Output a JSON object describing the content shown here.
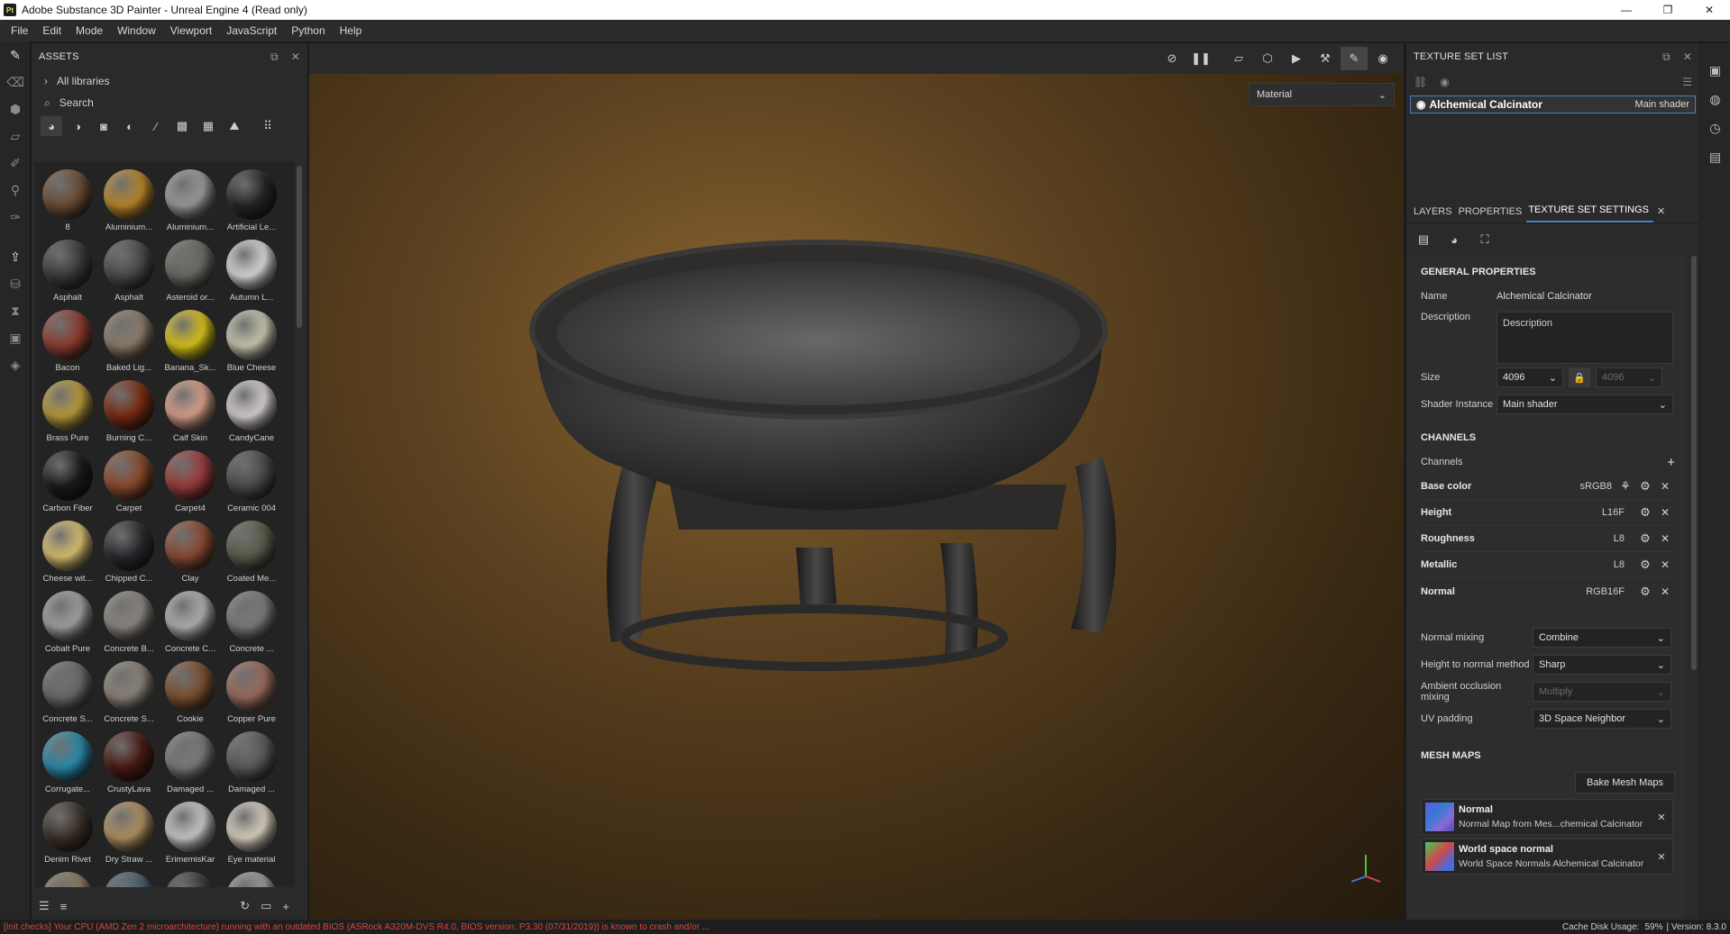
{
  "window": {
    "title": "Adobe Substance 3D Painter - Unreal Engine 4 (Read only)",
    "app_badge": "Pt",
    "minimize": "—",
    "maximize": "❐",
    "close": "✕"
  },
  "menu": [
    "File",
    "Edit",
    "Mode",
    "Window",
    "Viewport",
    "JavaScript",
    "Python",
    "Help"
  ],
  "assets": {
    "title": "ASSETS",
    "libraries": "All libraries",
    "search_placeholder": "Search",
    "items": [
      {
        "label": "8",
        "color": "#6b4c33"
      },
      {
        "label": "Aluminium...",
        "color": "#b8862a"
      },
      {
        "label": "Aluminium...",
        "color": "#9a9a9a"
      },
      {
        "label": "Artificial Le...",
        "color": "#262626"
      },
      {
        "label": "Asphalt",
        "color": "#3b3b3b"
      },
      {
        "label": "Asphalt",
        "color": "#4a4a4a"
      },
      {
        "label": "Asteroid or...",
        "color": "#6a6a62"
      },
      {
        "label": "Autumn L...",
        "color": "#d8d8d8"
      },
      {
        "label": "Bacon",
        "color": "#8c3b2e"
      },
      {
        "label": "Baked Lig...",
        "color": "#8c7c6a"
      },
      {
        "label": "Banana_Sk...",
        "color": "#d9c21a"
      },
      {
        "label": "Blue Cheese",
        "color": "#c9c6b0"
      },
      {
        "label": "Brass Pure",
        "color": "#b89a3a"
      },
      {
        "label": "Burning C...",
        "color": "#7a2a10"
      },
      {
        "label": "Calf Skin",
        "color": "#d8a08a"
      },
      {
        "label": "CandyCane",
        "color": "#d6d0d0"
      },
      {
        "label": "Carbon Fiber",
        "color": "#1a1a1a"
      },
      {
        "label": "Carpet",
        "color": "#8a4a2a"
      },
      {
        "label": "Carpet4",
        "color": "#9a3a3a"
      },
      {
        "label": "Ceramic 004",
        "color": "#4a4a4a"
      },
      {
        "label": "Cheese wit...",
        "color": "#d8c070"
      },
      {
        "label": "Chipped C...",
        "color": "#2a2a2e"
      },
      {
        "label": "Clay",
        "color": "#8a4a32"
      },
      {
        "label": "Coated Me...",
        "color": "#5a5a4a"
      },
      {
        "label": "Cobalt Pure",
        "color": "#a0a0a4"
      },
      {
        "label": "Concrete B...",
        "color": "#8a8680"
      },
      {
        "label": "Concrete C...",
        "color": "#b0b0b0"
      },
      {
        "label": "Concrete ...",
        "color": "#7a7a78"
      },
      {
        "label": "Concrete S...",
        "color": "#6a6a6a"
      },
      {
        "label": "Concrete S...",
        "color": "#8a8278"
      },
      {
        "label": "Cookie",
        "color": "#7a5030"
      },
      {
        "label": "Copper Pure",
        "color": "#9a6a5a"
      },
      {
        "label": "Corrugate...",
        "color": "#2a8aaa"
      },
      {
        "label": "CrustyLava",
        "color": "#4a1a12"
      },
      {
        "label": "Damaged ...",
        "color": "#7a7a78"
      },
      {
        "label": "Damaged ...",
        "color": "#5a5a5a"
      },
      {
        "label": "Denim Rivet",
        "color": "#3a3028"
      },
      {
        "label": "Dry Straw ...",
        "color": "#b09060"
      },
      {
        "label": "ErimemisKar",
        "color": "#c8c8c8"
      },
      {
        "label": "Eye material",
        "color": "#d8d0c0"
      },
      {
        "label": "",
        "color": "#8a7a60"
      },
      {
        "label": "",
        "color": "#4a6070"
      },
      {
        "label": "",
        "color": "#3a3a3a"
      },
      {
        "label": "",
        "color": "#9a9a9a"
      }
    ]
  },
  "viewport": {
    "mode": "Material"
  },
  "texture_set_list": {
    "title": "TEXTURE SET LIST",
    "set_name": "Alchemical Calcinator",
    "shader": "Main shader"
  },
  "tabs": {
    "layers": "LAYERS",
    "properties": "PROPERTIES",
    "tss": "TEXTURE SET SETTINGS"
  },
  "tss": {
    "general": "GENERAL PROPERTIES",
    "name_label": "Name",
    "name_value": "Alchemical Calcinator",
    "desc_label": "Description",
    "desc_value": "Description",
    "size_label": "Size",
    "size_value": "4096",
    "size_value2": "4096",
    "shader_label": "Shader Instance",
    "shader_value": "Main shader",
    "channels_section": "CHANNELS",
    "channels_label": "Channels",
    "channels": [
      {
        "name": "Base color",
        "format": "sRGB8"
      },
      {
        "name": "Height",
        "format": "L16F"
      },
      {
        "name": "Roughness",
        "format": "L8"
      },
      {
        "name": "Metallic",
        "format": "L8"
      },
      {
        "name": "Normal",
        "format": "RGB16F"
      }
    ],
    "normal_mixing_label": "Normal mixing",
    "normal_mixing": "Combine",
    "h2n_label": "Height to normal method",
    "h2n": "Sharp",
    "ao_label": "Ambient occlusion mixing",
    "ao": "Multiply",
    "uv_label": "UV padding",
    "uv": "3D Space Neighbor",
    "mesh_maps": "MESH MAPS",
    "bake": "Bake Mesh Maps",
    "maps": [
      {
        "title": "Normal",
        "sub": "Normal Map from Mes...chemical Calcinator"
      },
      {
        "title": "World space normal",
        "sub": "World Space Normals Alchemical Calcinator"
      }
    ]
  },
  "status": {
    "error": "[Init checks] Your CPU (AMD Zen 2 microarchitecture) running with an outdated BIOS (ASRock A320M-DVS R4.0, BIOS version: P3.30 (07/31/2019)) is known to crash and/or ...",
    "cache": "Cache Disk Usage:",
    "cache_value": "59%",
    "version": "| Version: 8.3.0"
  }
}
